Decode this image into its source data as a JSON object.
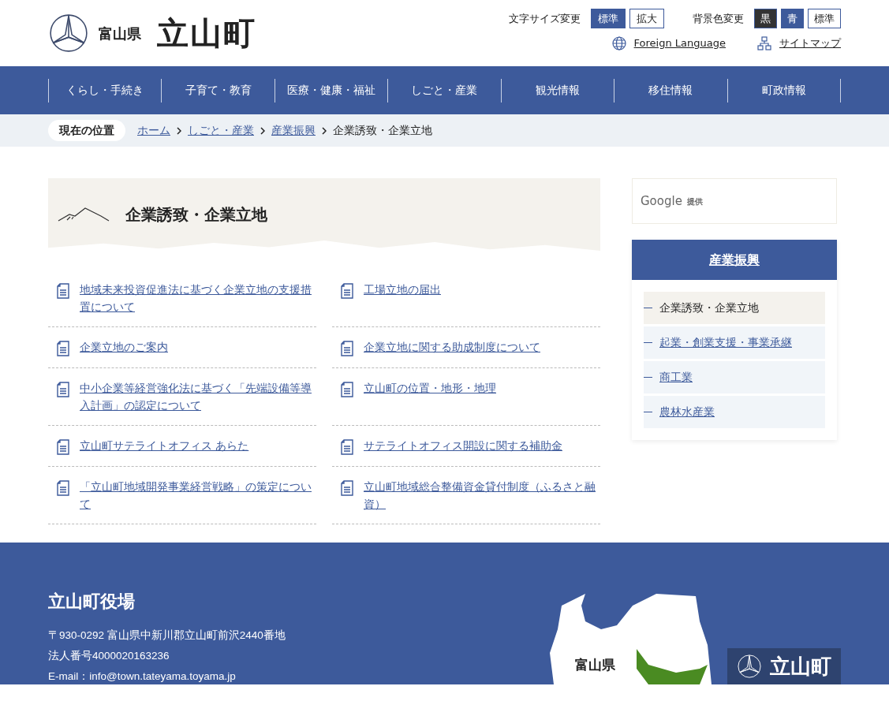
{
  "header": {
    "logo": {
      "prefecture": "富山県",
      "town": "立山町"
    },
    "font_size": {
      "label": "文字サイズ変更",
      "options": [
        {
          "label": "標準",
          "selected": true
        },
        {
          "label": "拡大",
          "selected": false
        }
      ]
    },
    "background": {
      "label": "背景色変更",
      "options": [
        {
          "label": "黒",
          "color": "#333333"
        },
        {
          "label": "青",
          "color": "#3d5a9b"
        },
        {
          "label": "標準",
          "color": "#ffffff"
        }
      ]
    },
    "links": [
      {
        "label": "Foreign Language",
        "kind": "globe"
      },
      {
        "label": "サイトマップ",
        "kind": "sitemap"
      }
    ]
  },
  "nav": [
    "くらし・手続き",
    "子育て・教育",
    "医療・健康・福祉",
    "しごと・産業",
    "観光情報",
    "移住情報",
    "町政情報"
  ],
  "breadcrumb": {
    "label": "現在の位置",
    "items": [
      {
        "label": "ホーム",
        "link": true
      },
      {
        "label": "しごと・産業",
        "link": true
      },
      {
        "label": "産業振興",
        "link": true
      },
      {
        "label": "企業誘致・企業立地",
        "link": false
      }
    ]
  },
  "page_title": "企業誘致・企業立地",
  "links": [
    "地域未来投資促進法に基づく企業立地の支援措置について",
    "工場立地の届出",
    "企業立地のご案内",
    "企業立地に関する助成制度について",
    "中小企業等経営強化法に基づく「先端設備等導入計画」の認定について",
    "立山町の位置・地形・地理",
    "立山町サテライトオフィス あらた",
    "サテライトオフィス開設に関する補助金",
    "「立山町地域開発事業経営戦略」の策定について",
    "立山町地域総合整備資金貸付制度（ふるさと融資）"
  ],
  "sidebar": {
    "search": {
      "brand": "Google",
      "suffix": "提供"
    },
    "title": "産業振興",
    "items": [
      {
        "label": "企業誘致・企業立地",
        "selected": true
      },
      {
        "label": "起業・創業支援・事業承継",
        "selected": false
      },
      {
        "label": "商工業",
        "selected": false
      },
      {
        "label": "農林水産業",
        "selected": false
      }
    ]
  },
  "footer": {
    "name": "立山町役場",
    "lines": [
      "〒930-0292 富山県中新川郡立山町前沢2440番地",
      "法人番号4000020163236",
      "E-mail：info@town.tateyama.toyama.jp"
    ],
    "map_label": "富山県",
    "badge": "立山町"
  }
}
